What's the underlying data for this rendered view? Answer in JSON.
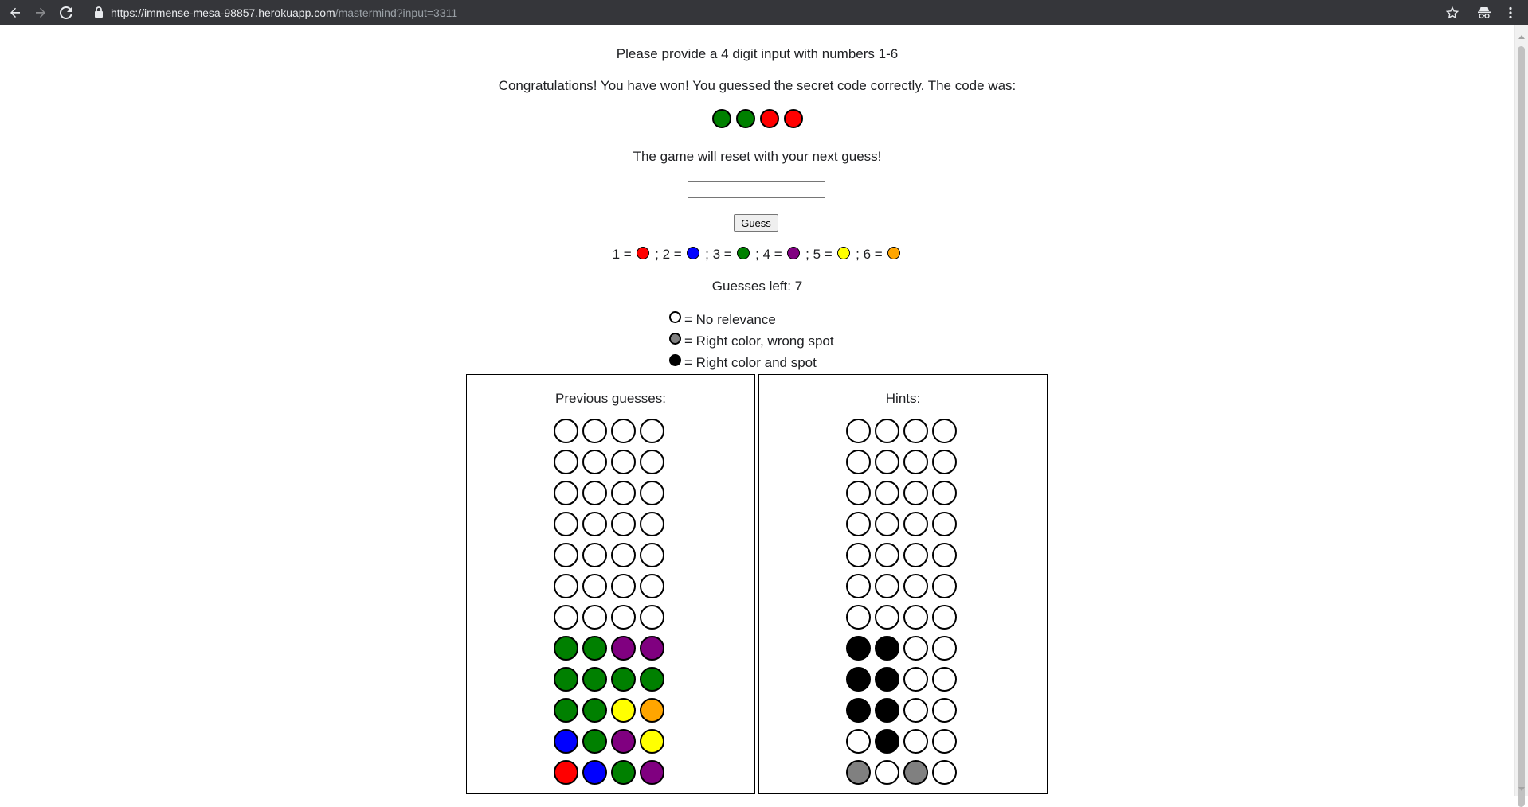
{
  "browser": {
    "url_host": "https://immense-mesa-98857.herokuapp.com",
    "url_path": "/mastermind?input=3311"
  },
  "colors": {
    "red": "#ff0000",
    "blue": "#0000ff",
    "green": "#008000",
    "purple": "#800080",
    "yellow": "#ffff00",
    "orange": "#ffa500",
    "black": "#000000",
    "gray": "#808080",
    "white": "#ffffff"
  },
  "prompt": "Please provide a 4 digit input with numbers 1-6",
  "win_message": "Congratulations! You have won! You guessed the secret code correctly. The code was:",
  "secret_code": [
    "green",
    "green",
    "red",
    "red"
  ],
  "reset_message": "The game will reset with your next guess!",
  "guess_input": {
    "value": "",
    "placeholder": ""
  },
  "guess_button_label": "Guess",
  "color_legend": [
    {
      "num": "1 =",
      "color": "red"
    },
    {
      "num": "; 2 =",
      "color": "blue"
    },
    {
      "num": "; 3 =",
      "color": "green"
    },
    {
      "num": "; 4 =",
      "color": "purple"
    },
    {
      "num": "; 5 =",
      "color": "yellow"
    },
    {
      "num": "; 6 =",
      "color": "orange"
    }
  ],
  "guesses_left": "Guesses left: 7",
  "hint_legend": [
    {
      "color": "white",
      "label": "= No relevance"
    },
    {
      "color": "gray",
      "label": "= Right color, wrong spot"
    },
    {
      "color": "black",
      "label": "= Right color and spot"
    }
  ],
  "previous_guesses": {
    "title": "Previous guesses:",
    "rows": [
      [
        "white",
        "white",
        "white",
        "white"
      ],
      [
        "white",
        "white",
        "white",
        "white"
      ],
      [
        "white",
        "white",
        "white",
        "white"
      ],
      [
        "white",
        "white",
        "white",
        "white"
      ],
      [
        "white",
        "white",
        "white",
        "white"
      ],
      [
        "white",
        "white",
        "white",
        "white"
      ],
      [
        "white",
        "white",
        "white",
        "white"
      ],
      [
        "green",
        "green",
        "purple",
        "purple"
      ],
      [
        "green",
        "green",
        "green",
        "green"
      ],
      [
        "green",
        "green",
        "yellow",
        "orange"
      ],
      [
        "blue",
        "green",
        "purple",
        "yellow"
      ],
      [
        "red",
        "blue",
        "green",
        "purple"
      ]
    ]
  },
  "hints": {
    "title": "Hints:",
    "rows": [
      [
        "white",
        "white",
        "white",
        "white"
      ],
      [
        "white",
        "white",
        "white",
        "white"
      ],
      [
        "white",
        "white",
        "white",
        "white"
      ],
      [
        "white",
        "white",
        "white",
        "white"
      ],
      [
        "white",
        "white",
        "white",
        "white"
      ],
      [
        "white",
        "white",
        "white",
        "white"
      ],
      [
        "white",
        "white",
        "white",
        "white"
      ],
      [
        "black",
        "black",
        "white",
        "white"
      ],
      [
        "black",
        "black",
        "white",
        "white"
      ],
      [
        "black",
        "black",
        "white",
        "white"
      ],
      [
        "white",
        "black",
        "white",
        "white"
      ],
      [
        "gray",
        "white",
        "gray",
        "white"
      ]
    ]
  }
}
